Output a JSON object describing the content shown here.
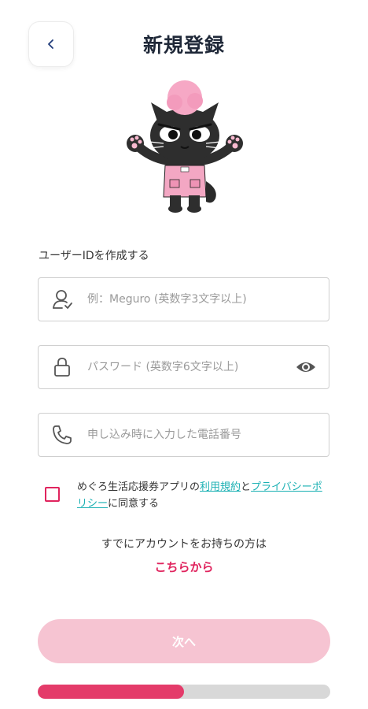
{
  "header": {
    "title": "新規登録",
    "back_icon": "chevron-left-icon"
  },
  "mascot": {
    "icon": "black-cat-mascot"
  },
  "form": {
    "section_label": "ユーザーIDを作成する",
    "user_id": {
      "icon": "user-icon",
      "placeholder": "例：Meguro (英数字3文字以上)",
      "value": ""
    },
    "password": {
      "icon": "lock-icon",
      "placeholder": "パスワード (英数字6文字以上)",
      "value": "",
      "toggle_icon": "eye-icon"
    },
    "phone": {
      "icon": "phone-icon",
      "placeholder": "申し込み時に入力した電話番号",
      "value": ""
    }
  },
  "agreement": {
    "checked": false,
    "text_before": "めぐろ生活応援券アプリの",
    "terms_link": "利用規約",
    "text_and": "と",
    "privacy_link": "プライバシーポリシー",
    "text_after": "に同意する"
  },
  "login_prompt": {
    "text": "すでにアカウントをお持ちの方は",
    "link": "こちらから"
  },
  "next_button": {
    "label": "次へ",
    "enabled": false
  },
  "progress": {
    "value": 0.5
  },
  "colors": {
    "accent": "#e0245e",
    "link": "#1ab0b3",
    "button_disabled": "#f6c4d2",
    "progress_fill": "#e43b6a"
  }
}
